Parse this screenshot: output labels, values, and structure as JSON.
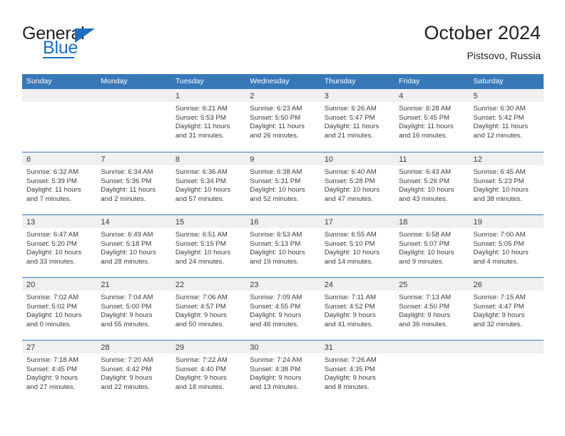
{
  "brand": {
    "name_top": "General",
    "name_bottom": "Blue",
    "logo_icon": "triangle-icon",
    "accent_color": "#1b6ec2"
  },
  "header": {
    "title": "October 2024",
    "subtitle": "Pistsovo, Russia"
  },
  "colors": {
    "header_row_bg": "#3878b9",
    "day_number_bg": "#f0f0f0",
    "text": "#3b3b3b",
    "rule": "#3878b9"
  },
  "weekdays": [
    "Sunday",
    "Monday",
    "Tuesday",
    "Wednesday",
    "Thursday",
    "Friday",
    "Saturday"
  ],
  "weeks": [
    [
      {
        "day": "",
        "lines": []
      },
      {
        "day": "",
        "lines": []
      },
      {
        "day": "1",
        "lines": [
          "Sunrise: 6:21 AM",
          "Sunset: 5:53 PM",
          "Daylight: 11 hours",
          "and 31 minutes."
        ]
      },
      {
        "day": "2",
        "lines": [
          "Sunrise: 6:23 AM",
          "Sunset: 5:50 PM",
          "Daylight: 11 hours",
          "and 26 minutes."
        ]
      },
      {
        "day": "3",
        "lines": [
          "Sunrise: 6:26 AM",
          "Sunset: 5:47 PM",
          "Daylight: 11 hours",
          "and 21 minutes."
        ]
      },
      {
        "day": "4",
        "lines": [
          "Sunrise: 6:28 AM",
          "Sunset: 5:45 PM",
          "Daylight: 11 hours",
          "and 16 minutes."
        ]
      },
      {
        "day": "5",
        "lines": [
          "Sunrise: 6:30 AM",
          "Sunset: 5:42 PM",
          "Daylight: 11 hours",
          "and 12 minutes."
        ]
      }
    ],
    [
      {
        "day": "6",
        "lines": [
          "Sunrise: 6:32 AM",
          "Sunset: 5:39 PM",
          "Daylight: 11 hours",
          "and 7 minutes."
        ]
      },
      {
        "day": "7",
        "lines": [
          "Sunrise: 6:34 AM",
          "Sunset: 5:36 PM",
          "Daylight: 11 hours",
          "and 2 minutes."
        ]
      },
      {
        "day": "8",
        "lines": [
          "Sunrise: 6:36 AM",
          "Sunset: 5:34 PM",
          "Daylight: 10 hours",
          "and 57 minutes."
        ]
      },
      {
        "day": "9",
        "lines": [
          "Sunrise: 6:38 AM",
          "Sunset: 5:31 PM",
          "Daylight: 10 hours",
          "and 52 minutes."
        ]
      },
      {
        "day": "10",
        "lines": [
          "Sunrise: 6:40 AM",
          "Sunset: 5:28 PM",
          "Daylight: 10 hours",
          "and 47 minutes."
        ]
      },
      {
        "day": "11",
        "lines": [
          "Sunrise: 6:43 AM",
          "Sunset: 5:26 PM",
          "Daylight: 10 hours",
          "and 43 minutes."
        ]
      },
      {
        "day": "12",
        "lines": [
          "Sunrise: 6:45 AM",
          "Sunset: 5:23 PM",
          "Daylight: 10 hours",
          "and 38 minutes."
        ]
      }
    ],
    [
      {
        "day": "13",
        "lines": [
          "Sunrise: 6:47 AM",
          "Sunset: 5:20 PM",
          "Daylight: 10 hours",
          "and 33 minutes."
        ]
      },
      {
        "day": "14",
        "lines": [
          "Sunrise: 6:49 AM",
          "Sunset: 5:18 PM",
          "Daylight: 10 hours",
          "and 28 minutes."
        ]
      },
      {
        "day": "15",
        "lines": [
          "Sunrise: 6:51 AM",
          "Sunset: 5:15 PM",
          "Daylight: 10 hours",
          "and 24 minutes."
        ]
      },
      {
        "day": "16",
        "lines": [
          "Sunrise: 6:53 AM",
          "Sunset: 5:13 PM",
          "Daylight: 10 hours",
          "and 19 minutes."
        ]
      },
      {
        "day": "17",
        "lines": [
          "Sunrise: 6:55 AM",
          "Sunset: 5:10 PM",
          "Daylight: 10 hours",
          "and 14 minutes."
        ]
      },
      {
        "day": "18",
        "lines": [
          "Sunrise: 6:58 AM",
          "Sunset: 5:07 PM",
          "Daylight: 10 hours",
          "and 9 minutes."
        ]
      },
      {
        "day": "19",
        "lines": [
          "Sunrise: 7:00 AM",
          "Sunset: 5:05 PM",
          "Daylight: 10 hours",
          "and 4 minutes."
        ]
      }
    ],
    [
      {
        "day": "20",
        "lines": [
          "Sunrise: 7:02 AM",
          "Sunset: 5:02 PM",
          "Daylight: 10 hours",
          "and 0 minutes."
        ]
      },
      {
        "day": "21",
        "lines": [
          "Sunrise: 7:04 AM",
          "Sunset: 5:00 PM",
          "Daylight: 9 hours",
          "and 55 minutes."
        ]
      },
      {
        "day": "22",
        "lines": [
          "Sunrise: 7:06 AM",
          "Sunset: 4:57 PM",
          "Daylight: 9 hours",
          "and 50 minutes."
        ]
      },
      {
        "day": "23",
        "lines": [
          "Sunrise: 7:09 AM",
          "Sunset: 4:55 PM",
          "Daylight: 9 hours",
          "and 46 minutes."
        ]
      },
      {
        "day": "24",
        "lines": [
          "Sunrise: 7:11 AM",
          "Sunset: 4:52 PM",
          "Daylight: 9 hours",
          "and 41 minutes."
        ]
      },
      {
        "day": "25",
        "lines": [
          "Sunrise: 7:13 AM",
          "Sunset: 4:50 PM",
          "Daylight: 9 hours",
          "and 36 minutes."
        ]
      },
      {
        "day": "26",
        "lines": [
          "Sunrise: 7:15 AM",
          "Sunset: 4:47 PM",
          "Daylight: 9 hours",
          "and 32 minutes."
        ]
      }
    ],
    [
      {
        "day": "27",
        "lines": [
          "Sunrise: 7:18 AM",
          "Sunset: 4:45 PM",
          "Daylight: 9 hours",
          "and 27 minutes."
        ]
      },
      {
        "day": "28",
        "lines": [
          "Sunrise: 7:20 AM",
          "Sunset: 4:42 PM",
          "Daylight: 9 hours",
          "and 22 minutes."
        ]
      },
      {
        "day": "29",
        "lines": [
          "Sunrise: 7:22 AM",
          "Sunset: 4:40 PM",
          "Daylight: 9 hours",
          "and 18 minutes."
        ]
      },
      {
        "day": "30",
        "lines": [
          "Sunrise: 7:24 AM",
          "Sunset: 4:38 PM",
          "Daylight: 9 hours",
          "and 13 minutes."
        ]
      },
      {
        "day": "31",
        "lines": [
          "Sunrise: 7:26 AM",
          "Sunset: 4:35 PM",
          "Daylight: 9 hours",
          "and 8 minutes."
        ]
      },
      {
        "day": "",
        "lines": []
      },
      {
        "day": "",
        "lines": []
      }
    ]
  ]
}
